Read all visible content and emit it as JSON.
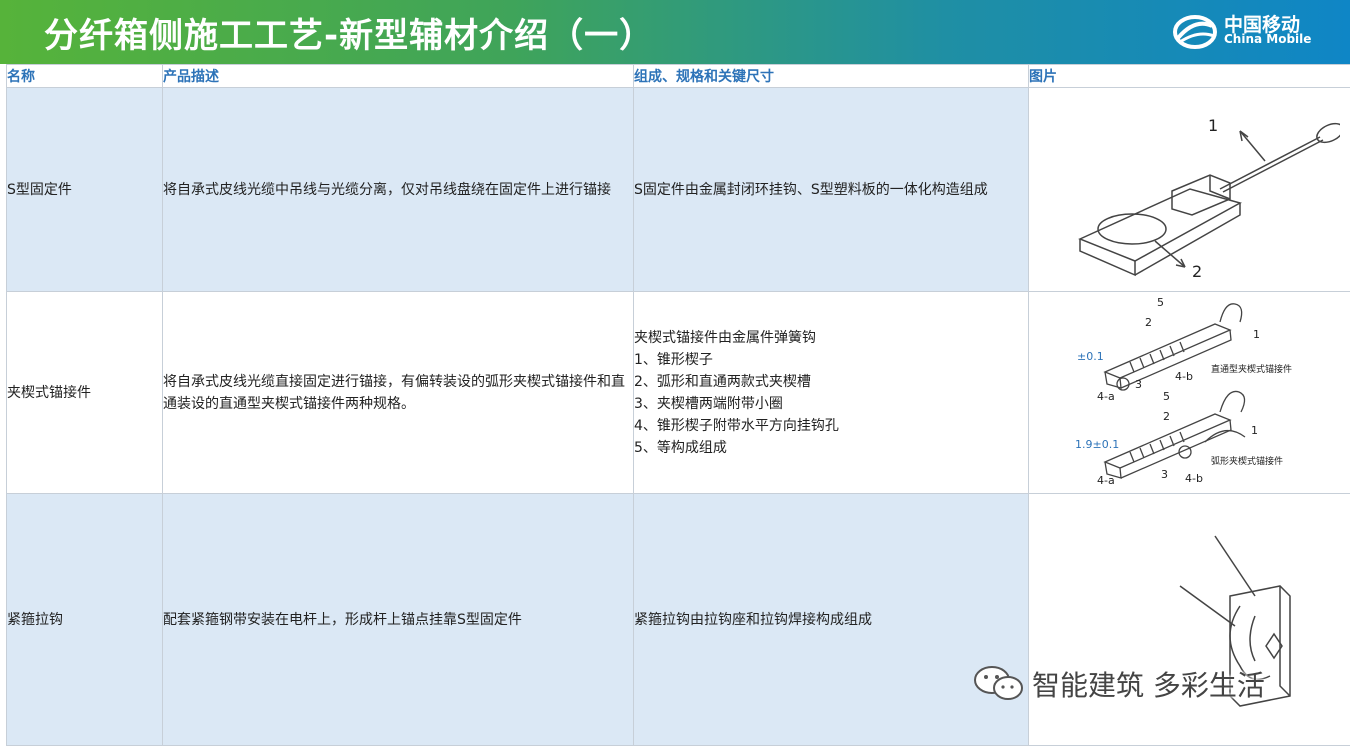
{
  "title": "分纤箱侧施工工艺-新型辅材介绍（一）",
  "logo": {
    "cn": "中国移动",
    "en": "China Mobile",
    "icon": "china-mobile-logo-icon"
  },
  "colors": {
    "banner_start": "#56b33a",
    "banner_end": "#0f86c6",
    "header_text": "#2d73b8",
    "row_tint": "#dbe8f5"
  },
  "table": {
    "headers": [
      "名称",
      "产品描述",
      "组成、规格和关键尺寸",
      "图片"
    ],
    "rows": [
      {
        "name": "S型固定件",
        "desc": "将自承式皮线光缆中吊线与光缆分离，仅对吊线盘绕在固定件上进行锚接",
        "spec": [
          "S固定件由金属封闭环挂钩、S型塑料板的一体化构造组成"
        ],
        "img_labels": [
          "1",
          "2"
        ]
      },
      {
        "name": "夹楔式锚接件",
        "desc": "将自承式皮线光缆直接固定进行锚接，有偏转装设的弧形夹楔式锚接件和直通装设的直通型夹楔式锚接件两种规格。",
        "spec": [
          "夹楔式锚接件由金属件弹簧钩",
          "1、锥形楔子",
          "2、弧形和直通两款式夹楔槽",
          "3、夹楔槽两端附带小圈",
          "4、锥形楔子附带水平方向挂钩孔",
          "5、等构成组成"
        ],
        "img_labels": {
          "top": [
            "5",
            "2",
            "1",
            "±0.1",
            "3",
            "4-a",
            "4-b",
            "直通型夹楔式锚接件"
          ],
          "bottom": [
            "5",
            "2",
            "1",
            "1.9±0.1",
            "3",
            "4-a",
            "4-b",
            "弧形夹楔式锚接件"
          ]
        }
      },
      {
        "name": "紧箍拉钩",
        "desc": "配套紧箍钢带安装在电杆上，形成杆上锚点挂靠S型固定件",
        "spec": [
          "紧箍拉钩由拉钩座和拉钩焊接构成组成"
        ]
      }
    ]
  },
  "watermark": {
    "text": "智能建筑 多彩生活",
    "icon": "wechat-icon"
  }
}
